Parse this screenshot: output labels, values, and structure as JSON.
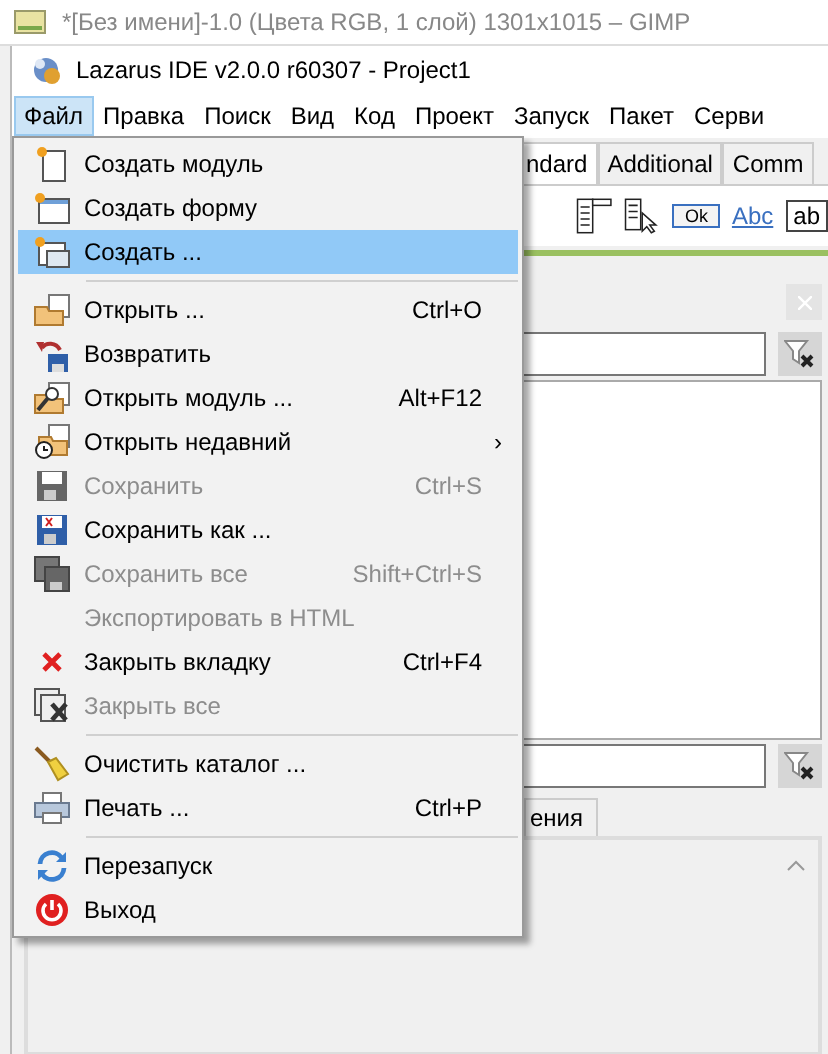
{
  "background_window": {
    "title": "*[Без имени]-1.0 (Цвета RGB, 1 слой) 1301x1015 – GIMP"
  },
  "window": {
    "title": "Lazarus IDE v2.0.0 r60307 - Project1"
  },
  "menubar": [
    {
      "label": "Файл",
      "selected": true
    },
    {
      "label": "Правка",
      "selected": false
    },
    {
      "label": "Поиск",
      "selected": false
    },
    {
      "label": "Вид",
      "selected": false
    },
    {
      "label": "Код",
      "selected": false
    },
    {
      "label": "Проект",
      "selected": false
    },
    {
      "label": "Запуск",
      "selected": false
    },
    {
      "label": "Пакет",
      "selected": false
    },
    {
      "label": "Серви",
      "selected": false
    }
  ],
  "palette": {
    "tabs": [
      {
        "label": "ndard",
        "selected": true
      },
      {
        "label": "Additional",
        "selected": false
      },
      {
        "label": "Comm",
        "selected": false
      }
    ],
    "components": [
      {
        "kind": "mainmenu"
      },
      {
        "kind": "popupmenu"
      },
      {
        "kind": "button",
        "label": "Ok"
      },
      {
        "kind": "label",
        "label": "Abc"
      },
      {
        "kind": "edit",
        "label": "ab"
      }
    ]
  },
  "panel": {
    "tab": "ения"
  },
  "menu": [
    {
      "kind": "item",
      "label": "Создать модуль",
      "selected": false,
      "disabled": false
    },
    {
      "kind": "item",
      "label": "Создать форму",
      "selected": false,
      "disabled": false
    },
    {
      "kind": "item",
      "label": "Создать ...",
      "selected": true,
      "disabled": false
    },
    {
      "kind": "separator"
    },
    {
      "kind": "item",
      "label": "Открыть ...",
      "shortcut": "Ctrl+O",
      "selected": false,
      "disabled": false
    },
    {
      "kind": "item",
      "label": "Возвратить",
      "selected": false,
      "disabled": false
    },
    {
      "kind": "item",
      "label": "Открыть модуль ...",
      "shortcut": "Alt+F12",
      "selected": false,
      "disabled": false
    },
    {
      "kind": "item",
      "label": "Открыть недавний",
      "submenu": "›",
      "selected": false,
      "disabled": false
    },
    {
      "kind": "item",
      "label": "Сохранить",
      "shortcut": "Ctrl+S",
      "selected": false,
      "disabled": true
    },
    {
      "kind": "item",
      "label": "Сохранить как ...",
      "selected": false,
      "disabled": false
    },
    {
      "kind": "item",
      "label": "Сохранить все",
      "shortcut": "Shift+Ctrl+S",
      "selected": false,
      "disabled": true
    },
    {
      "kind": "item",
      "label": "Экспортировать в HTML",
      "selected": false,
      "disabled": true
    },
    {
      "kind": "item",
      "label": "Закрыть вкладку",
      "shortcut": "Ctrl+F4",
      "selected": false,
      "disabled": false
    },
    {
      "kind": "item",
      "label": "Закрыть все",
      "selected": false,
      "disabled": true
    },
    {
      "kind": "separator"
    },
    {
      "kind": "item",
      "label": "Очистить каталог ...",
      "selected": false,
      "disabled": false
    },
    {
      "kind": "item",
      "label": "Печать ...",
      "shortcut": "Ctrl+P",
      "selected": false,
      "disabled": false
    },
    {
      "kind": "separator"
    },
    {
      "kind": "item",
      "label": "Перезапуск",
      "selected": false,
      "disabled": false
    },
    {
      "kind": "item",
      "label": "Выход",
      "selected": false,
      "disabled": false
    }
  ]
}
